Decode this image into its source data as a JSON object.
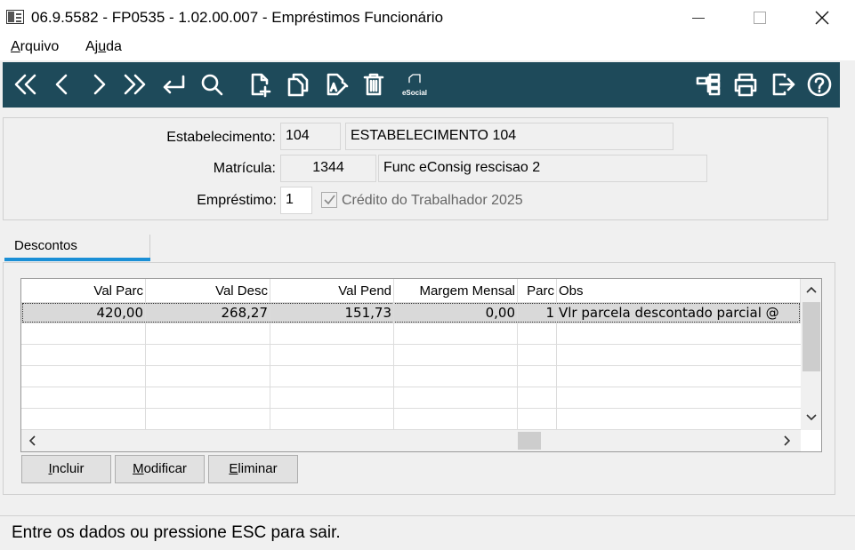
{
  "window": {
    "title": "06.9.5582 - FP0535 - 1.02.00.007 - Empréstimos Funcionário"
  },
  "menu": {
    "arquivo_prefix": "",
    "arquivo_hot": "A",
    "arquivo_rest": "rquivo",
    "ajuda_prefix": "Aj",
    "ajuda_hot": "u",
    "ajuda_rest": "da"
  },
  "toolbar": {
    "esocial_label": "eSocial",
    "background": "#1e4a5a"
  },
  "form": {
    "estabelecimento_label": "Estabelecimento:",
    "estabelecimento_code": "104",
    "estabelecimento_name": "ESTABELECIMENTO 104",
    "matricula_label": "Matrícula:",
    "matricula_code": "1344",
    "matricula_name": "Func  eConsig rescisao 2",
    "emprestimo_label": "Empréstimo:",
    "emprestimo_value": "1",
    "credito_label": "Crédito do Trabalhador 2025",
    "credito_checked": true
  },
  "tabs": {
    "active_label": "Descontos"
  },
  "grid": {
    "columns": [
      "Val Parc",
      "Val Desc",
      "Val Pend",
      "Margem Mensal",
      "Parc",
      "Obs"
    ],
    "rows": [
      {
        "val_parc": "420,00",
        "val_desc": "268,27",
        "val_pend": "151,73",
        "margem": "0,00",
        "parc": "1",
        "obs": "Vlr parcela descontado parcial @"
      }
    ]
  },
  "buttons": {
    "incluir_hot": "I",
    "incluir_rest": "ncluir",
    "modificar_hot": "M",
    "modificar_rest": "odificar",
    "eliminar_hot": "E",
    "eliminar_rest": "liminar"
  },
  "status": {
    "text": "Entre os dados ou pressione ESC para sair."
  },
  "colors": {
    "tab_accent": "#1a8fd6"
  }
}
